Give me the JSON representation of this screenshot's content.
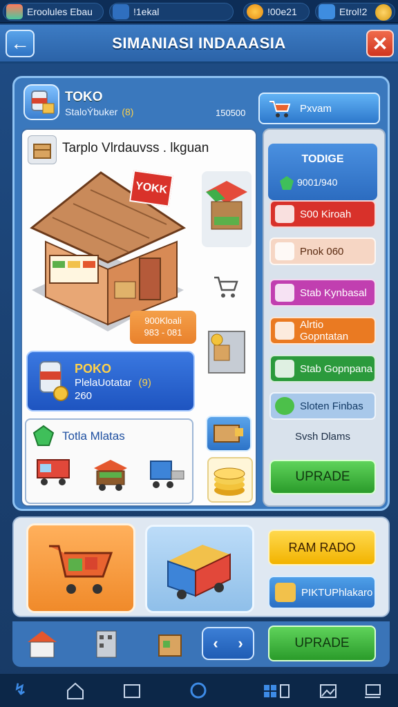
{
  "statusbar": {
    "item1": "Eroolules Ebau",
    "item2": "!1ekal",
    "item3": "!00e21",
    "item4": "Etrol!2"
  },
  "header": {
    "title": "SIMANIASI INDAAASIA"
  },
  "store": {
    "name": "TOKO",
    "subtitle": "StaloÝbuker",
    "level": "(8)",
    "number": "150500",
    "action_label": "Pxvam"
  },
  "display": {
    "heading": "Tarplo Vlrdauvss . lkguan",
    "sign": "YOKK",
    "price_tag_line1": "900Kloali",
    "price_tag_line2": "983 - 081"
  },
  "info_card": {
    "title": "POKO",
    "subtitle": "PlelaUotatar",
    "level": "(9)",
    "value": "260"
  },
  "vehicles": {
    "title": "Totla Mlatas"
  },
  "right_menu": {
    "today_title": "TODIGE",
    "today_value": "9001/940",
    "items": [
      {
        "label": "S00 Kiroah",
        "color": "#d8312a"
      },
      {
        "label": "Pnok 060",
        "color": "#f6d6c4"
      },
      {
        "label": "Stab Kynbasal",
        "color": "#c13fb0"
      },
      {
        "label": "Alrtio Gopntatan",
        "color": "#ea7a22"
      },
      {
        "label": "Stab Gopnpana",
        "color": "#2b9a3c"
      },
      {
        "label": "Sloten Finbas",
        "color": "#a8c8ea"
      }
    ],
    "note": "Svsh Dlams",
    "upgrade_label": "UPRADE"
  },
  "bottom": {
    "yellow_button": "RAM RADO",
    "blue_button": "PIKTUPhlakaro",
    "upgrade_label": "UPRADE"
  }
}
